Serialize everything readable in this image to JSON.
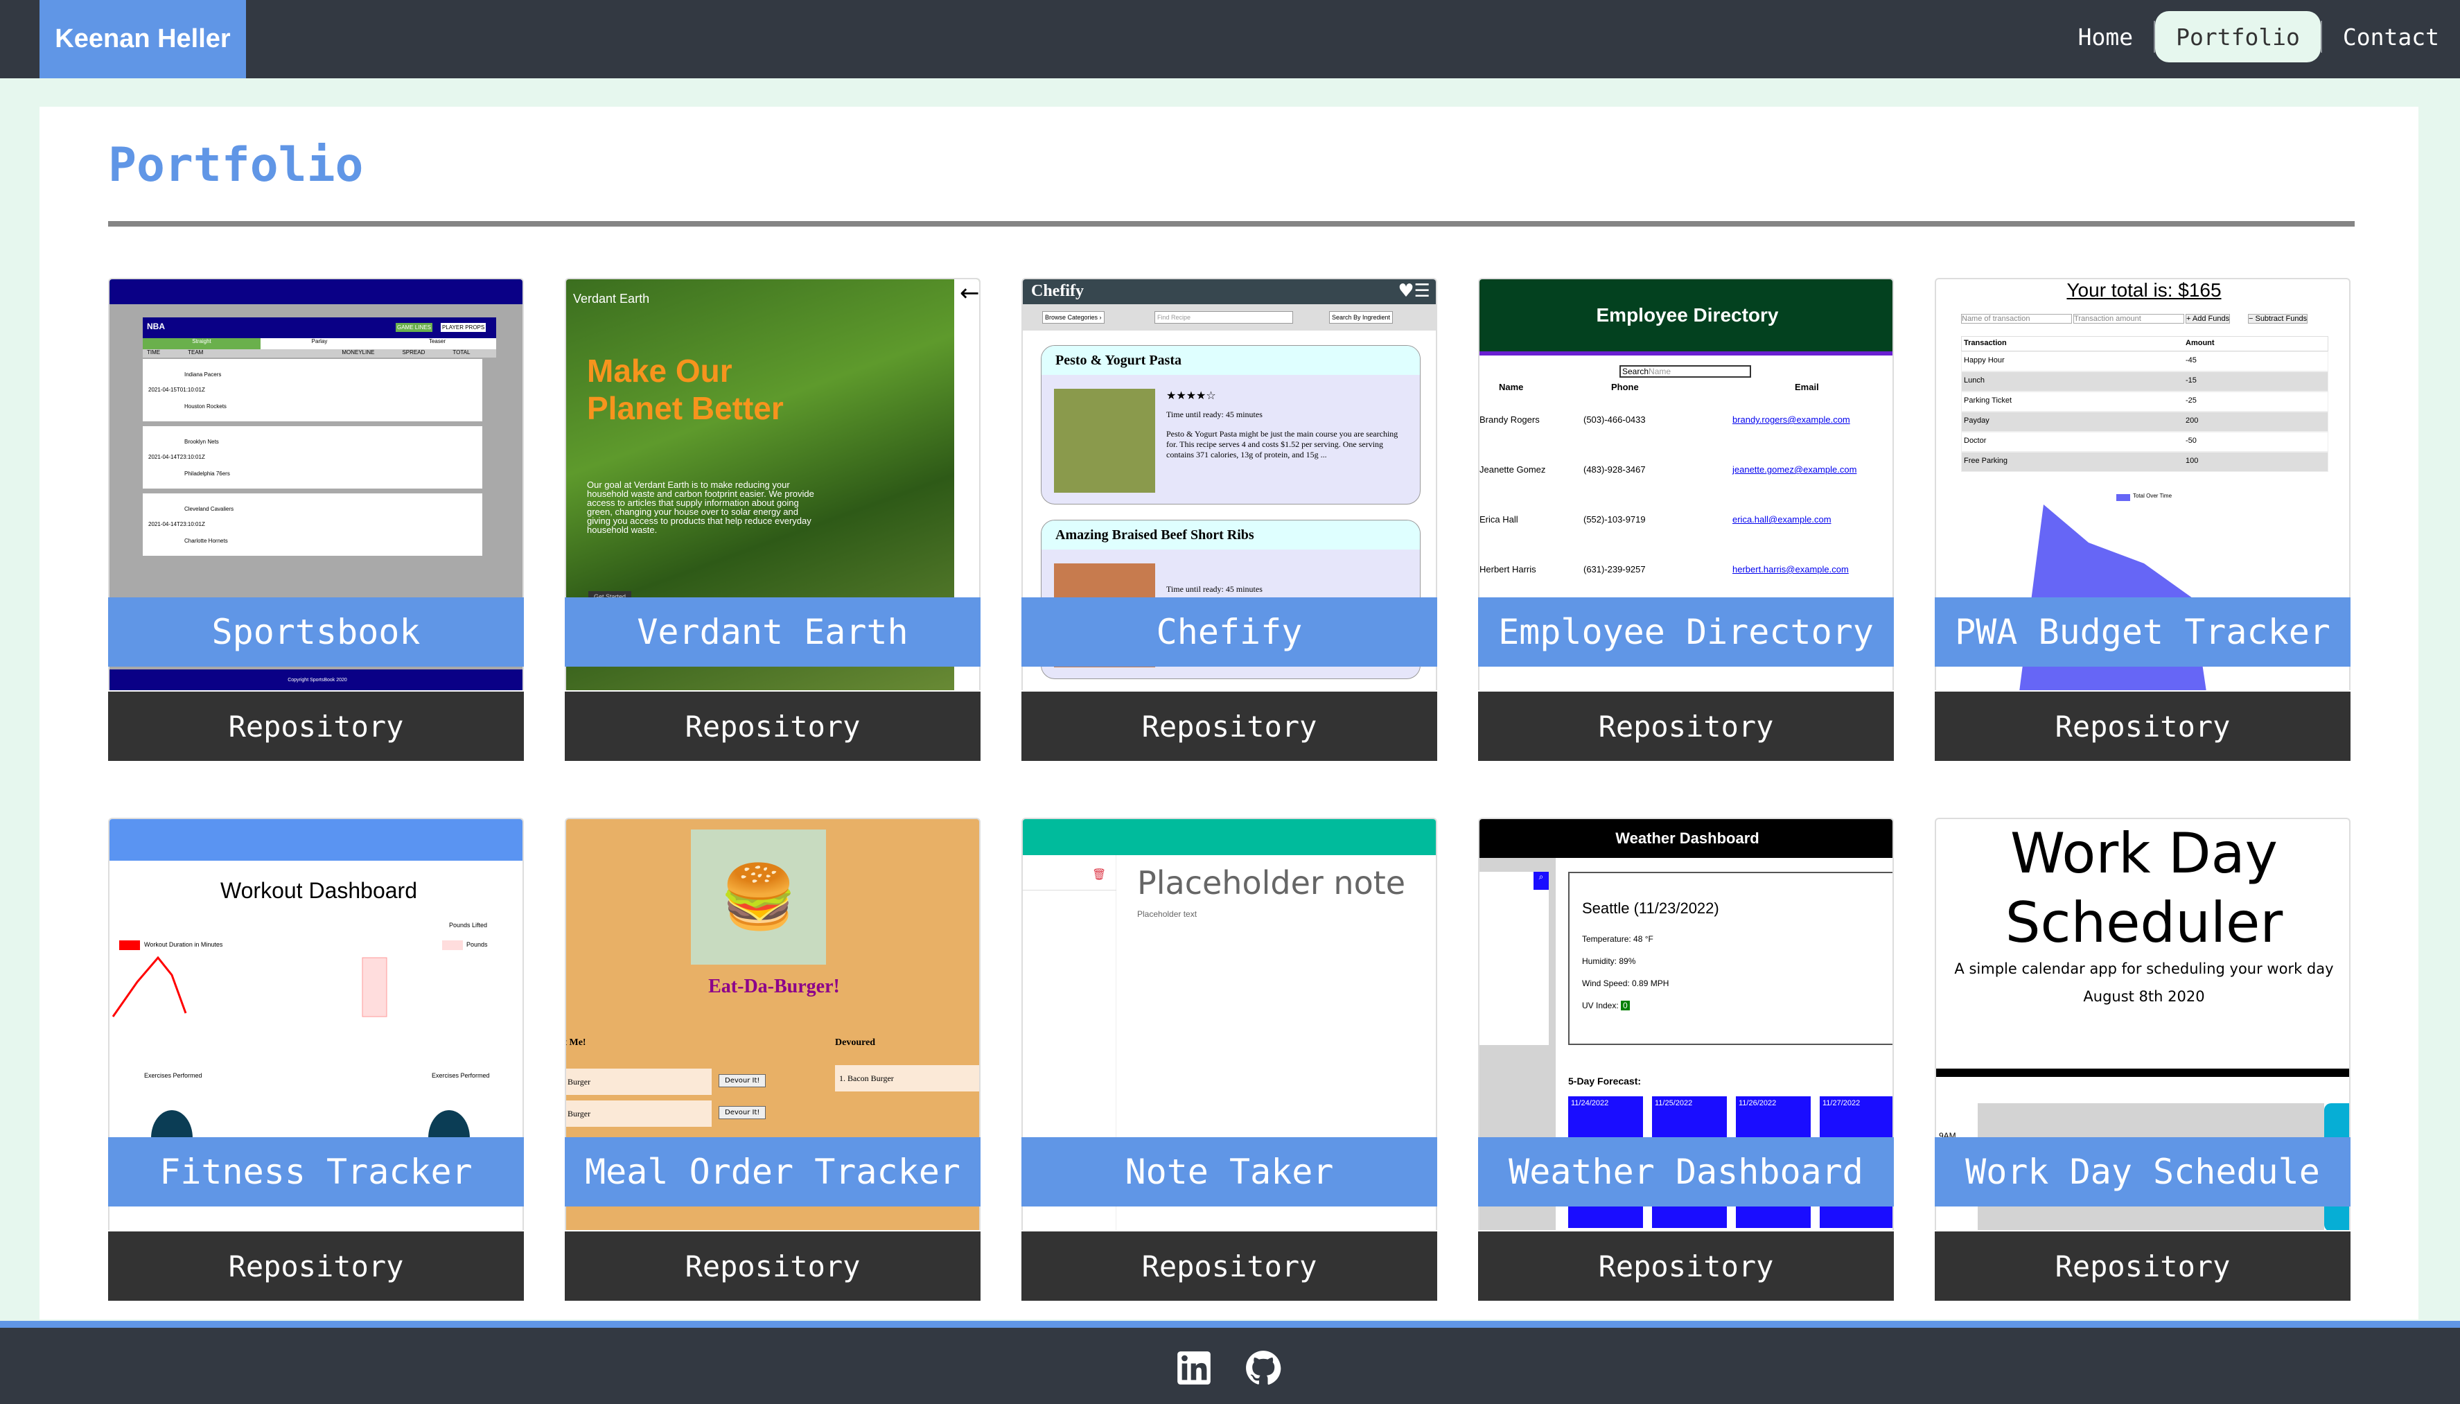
{
  "header": {
    "brand": "Keenan Heller",
    "nav": [
      {
        "label": "Home"
      },
      {
        "label": "Portfolio",
        "active": true
      },
      {
        "label": "Contact"
      }
    ]
  },
  "page": {
    "title": "Portfolio"
  },
  "colors": {
    "accent": "#6096e6",
    "nav_bg": "#333942",
    "page_bg": "#e6f7ee",
    "repo_bg": "#333333"
  },
  "projects": [
    {
      "title": "Sportsbook",
      "repo": "Repository",
      "preview": {
        "league": "NBA",
        "tabs": [
          "GAME LINES",
          "PLAYER PROPS"
        ],
        "bet_types": [
          "Straight",
          "Parlay",
          "Teaser"
        ],
        "columns": [
          "TIME",
          "TEAM",
          "MONEYLINE",
          "SPREAD",
          "TOTAL"
        ],
        "games": [
          {
            "time": "2021-04-15T01:10:01Z",
            "teams": [
              "Indiana Pacers",
              "Houston Rockets"
            ]
          },
          {
            "time": "2021-04-14T23:10:01Z",
            "teams": [
              "Brooklyn Nets",
              "Philadelphia 76ers"
            ]
          },
          {
            "time": "2021-04-14T23:10:01Z",
            "teams": [
              "Cleveland Cavaliers",
              "Charlotte Hornets"
            ]
          }
        ],
        "footer": "Copyright SportsBook 2020"
      }
    },
    {
      "title": "Verdant Earth",
      "repo": "Repository",
      "preview": {
        "brand": "Verdant Earth",
        "headline": "Make Our Planet Better",
        "body": "Our goal at Verdant Earth is to make reducing your household waste and carbon footprint easier. We provide access to articles that supply information about going green, changing your house over to solar energy and giving you access to products that help reduce everyday household waste.",
        "cta": "Get Started"
      }
    },
    {
      "title": "Chefify",
      "repo": "Repository",
      "preview": {
        "brand": "Chefify",
        "browse": "Browse Categories ›",
        "search_placeholder": "Find Recipe",
        "by_ingredient": "Search By Ingredient",
        "recipes": [
          {
            "name": "Pesto & Yogurt Pasta",
            "time": "Time until ready: 45 minutes",
            "desc": "Pesto & Yogurt Pasta might be just the main course you are searching for. This recipe serves 4 and costs $1.52 per serving. One serving contains 371 calories, 13g of protein, and 15g ..."
          },
          {
            "name": "Amazing Braised Beef Short Ribs",
            "time": "Time until ready: 45 minutes"
          }
        ]
      }
    },
    {
      "title": "Employee Directory",
      "repo": "Repository",
      "preview": {
        "heading": "Employee Directory",
        "search_label": "Search",
        "search_placeholder": "Name",
        "columns": [
          "Name",
          "Phone",
          "Email"
        ],
        "rows": [
          [
            "Brandy Rogers",
            "(503)-466-0433",
            "brandy.rogers@example.com"
          ],
          [
            "Jeanette Gomez",
            "(483)-928-3467",
            "jeanette.gomez@example.com"
          ],
          [
            "Erica Hall",
            "(552)-103-9719",
            "erica.hall@example.com"
          ],
          [
            "Herbert Harris",
            "(631)-239-9257",
            "herbert.harris@example.com"
          ]
        ]
      }
    },
    {
      "title": "PWA Budget Tracker",
      "repo": "Repository",
      "preview": {
        "total": "Your total is: $165",
        "name_placeholder": "Name of transaction",
        "amount_placeholder": "Transaction amount",
        "add": "+ Add Funds",
        "subtract": "− Subtract Funds",
        "columns": [
          "Transaction",
          "Amount"
        ],
        "rows": [
          [
            "Happy Hour",
            "-45"
          ],
          [
            "Lunch",
            "-15"
          ],
          [
            "Parking Ticket",
            "-25"
          ],
          [
            "Payday",
            "200"
          ],
          [
            "Doctor",
            "-50"
          ],
          [
            "Free Parking",
            "100"
          ]
        ],
        "legend": "Total Over Time"
      }
    },
    {
      "title": "Fitness Tracker",
      "repo": "Repository",
      "preview": {
        "heading": "Workout Dashboard",
        "chart1_legend": "Workout Duration in Minutes",
        "chart2_title": "Pounds Lifted",
        "chart2_legend": "Pounds",
        "pie_title": "Exercises Performed"
      }
    },
    {
      "title": "Meal Order Tracker",
      "repo": "Repository",
      "preview": {
        "heading": "Eat-Da-Burger!",
        "col1": "Eat Me!",
        "col2": "Devoured",
        "items": [
          "Burger",
          "Burger"
        ],
        "devour": "Devour It!",
        "devoured": [
          "1. Bacon Burger"
        ]
      }
    },
    {
      "title": "Note Taker",
      "repo": "Repository",
      "preview": {
        "note_title": "Placeholder note",
        "note_text": "Placeholder text"
      }
    },
    {
      "title": "Weather Dashboard",
      "repo": "Repository",
      "preview": {
        "heading": "Weather Dashboard",
        "city": "Seattle (11/23/2022)",
        "temp": "Temperature: 48 °F",
        "humidity": "Humidity: 89%",
        "wind": "Wind Speed: 0.89 MPH",
        "uv_label": "UV Index:",
        "uv": "0",
        "forecast_label": "5-Day Forecast:",
        "days": [
          "11/24/2022",
          "11/25/2022",
          "11/26/2022",
          "11/27/2022"
        ]
      }
    },
    {
      "title": "Work Day Schedule",
      "repo": "Repository",
      "preview": {
        "heading": "Work Day Scheduler",
        "sub": "A simple calendar app for scheduling your work day",
        "date": "August 8th 2020",
        "hour": "9AM"
      }
    }
  ],
  "footer": {
    "icons": [
      "linkedin-icon",
      "github-icon"
    ]
  }
}
